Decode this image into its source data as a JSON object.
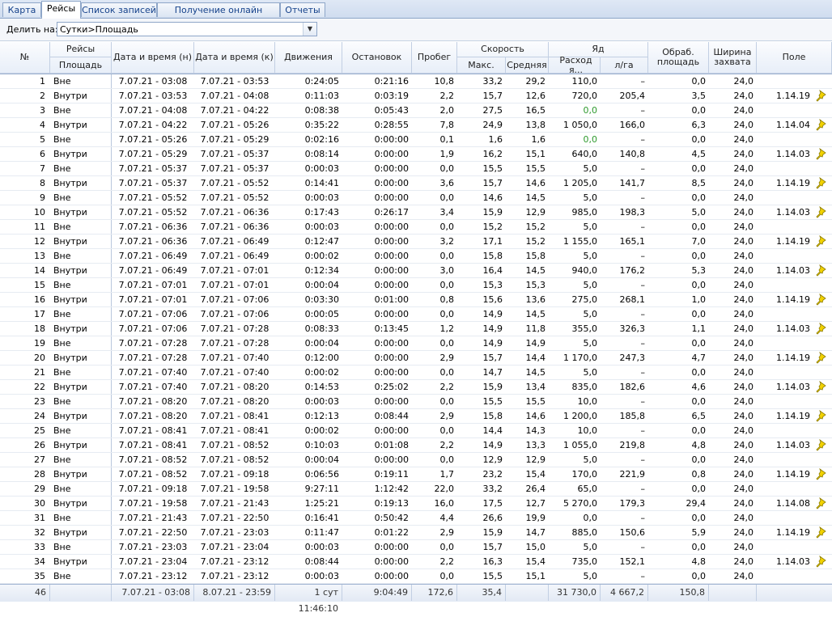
{
  "tabs": [
    {
      "label": "Карта",
      "active": false
    },
    {
      "label": "Рейсы",
      "active": true
    },
    {
      "label": "Список записей",
      "active": false
    },
    {
      "label": "Получение онлайн данных",
      "active": false
    },
    {
      "label": "Отчеты",
      "active": false
    }
  ],
  "toolbar": {
    "split_label": "Делить на:",
    "split_value": "Сутки>Площадь"
  },
  "columns": {
    "num": "№",
    "trips": "Рейсы",
    "area": "Площадь",
    "dt_start": "Дата и время (н)",
    "dt_end": "Дата и время (к)",
    "moving": "Движения",
    "stops": "Остановок",
    "mileage": "Пробег",
    "speed": "Скорость",
    "speed_max": "Макс.",
    "speed_avg": "Средняя",
    "poison": "Яд",
    "poison_use": "Расход я...",
    "poison_per_ha": "л/га",
    "processed": "Обраб. площадь",
    "width": "Ширина захвата",
    "field": "Поле"
  },
  "rows": [
    [
      "1",
      "Вне",
      "7.07.21 - 03:08",
      "7.07.21 - 03:53",
      "0:24:05",
      "0:21:16",
      "10,8",
      "33,2",
      "29,2",
      "110,0",
      "–",
      "0,0",
      "24,0",
      ""
    ],
    [
      "2",
      "Внутри",
      "7.07.21 - 03:53",
      "7.07.21 - 04:08",
      "0:11:03",
      "0:03:19",
      "2,2",
      "15,7",
      "12,6",
      "720,0",
      "205,4",
      "3,5",
      "24,0",
      "1.14.19"
    ],
    [
      "3",
      "Вне",
      "7.07.21 - 04:08",
      "7.07.21 - 04:22",
      "0:08:38",
      "0:05:43",
      "2,0",
      "27,5",
      "16,5",
      "0,0",
      "–",
      "0,0",
      "24,0",
      ""
    ],
    [
      "4",
      "Внутри",
      "7.07.21 - 04:22",
      "7.07.21 - 05:26",
      "0:35:22",
      "0:28:55",
      "7,8",
      "24,9",
      "13,8",
      "1 050,0",
      "166,0",
      "6,3",
      "24,0",
      "1.14.04"
    ],
    [
      "5",
      "Вне",
      "7.07.21 - 05:26",
      "7.07.21 - 05:29",
      "0:02:16",
      "0:00:00",
      "0,1",
      "1,6",
      "1,6",
      "0,0",
      "–",
      "0,0",
      "24,0",
      ""
    ],
    [
      "6",
      "Внутри",
      "7.07.21 - 05:29",
      "7.07.21 - 05:37",
      "0:08:14",
      "0:00:00",
      "1,9",
      "16,2",
      "15,1",
      "640,0",
      "140,8",
      "4,5",
      "24,0",
      "1.14.03"
    ],
    [
      "7",
      "Вне",
      "7.07.21 - 05:37",
      "7.07.21 - 05:37",
      "0:00:03",
      "0:00:00",
      "0,0",
      "15,5",
      "15,5",
      "5,0",
      "–",
      "0,0",
      "24,0",
      ""
    ],
    [
      "8",
      "Внутри",
      "7.07.21 - 05:37",
      "7.07.21 - 05:52",
      "0:14:41",
      "0:00:00",
      "3,6",
      "15,7",
      "14,6",
      "1 205,0",
      "141,7",
      "8,5",
      "24,0",
      "1.14.19"
    ],
    [
      "9",
      "Вне",
      "7.07.21 - 05:52",
      "7.07.21 - 05:52",
      "0:00:03",
      "0:00:00",
      "0,0",
      "14,6",
      "14,5",
      "5,0",
      "–",
      "0,0",
      "24,0",
      ""
    ],
    [
      "10",
      "Внутри",
      "7.07.21 - 05:52",
      "7.07.21 - 06:36",
      "0:17:43",
      "0:26:17",
      "3,4",
      "15,9",
      "12,9",
      "985,0",
      "198,3",
      "5,0",
      "24,0",
      "1.14.03"
    ],
    [
      "11",
      "Вне",
      "7.07.21 - 06:36",
      "7.07.21 - 06:36",
      "0:00:03",
      "0:00:00",
      "0,0",
      "15,2",
      "15,2",
      "5,0",
      "–",
      "0,0",
      "24,0",
      ""
    ],
    [
      "12",
      "Внутри",
      "7.07.21 - 06:36",
      "7.07.21 - 06:49",
      "0:12:47",
      "0:00:00",
      "3,2",
      "17,1",
      "15,2",
      "1 155,0",
      "165,1",
      "7,0",
      "24,0",
      "1.14.19"
    ],
    [
      "13",
      "Вне",
      "7.07.21 - 06:49",
      "7.07.21 - 06:49",
      "0:00:02",
      "0:00:00",
      "0,0",
      "15,8",
      "15,8",
      "5,0",
      "–",
      "0,0",
      "24,0",
      ""
    ],
    [
      "14",
      "Внутри",
      "7.07.21 - 06:49",
      "7.07.21 - 07:01",
      "0:12:34",
      "0:00:00",
      "3,0",
      "16,4",
      "14,5",
      "940,0",
      "176,2",
      "5,3",
      "24,0",
      "1.14.03"
    ],
    [
      "15",
      "Вне",
      "7.07.21 - 07:01",
      "7.07.21 - 07:01",
      "0:00:04",
      "0:00:00",
      "0,0",
      "15,3",
      "15,3",
      "5,0",
      "–",
      "0,0",
      "24,0",
      ""
    ],
    [
      "16",
      "Внутри",
      "7.07.21 - 07:01",
      "7.07.21 - 07:06",
      "0:03:30",
      "0:01:00",
      "0,8",
      "15,6",
      "13,6",
      "275,0",
      "268,1",
      "1,0",
      "24,0",
      "1.14.19"
    ],
    [
      "17",
      "Вне",
      "7.07.21 - 07:06",
      "7.07.21 - 07:06",
      "0:00:05",
      "0:00:00",
      "0,0",
      "14,9",
      "14,5",
      "5,0",
      "–",
      "0,0",
      "24,0",
      ""
    ],
    [
      "18",
      "Внутри",
      "7.07.21 - 07:06",
      "7.07.21 - 07:28",
      "0:08:33",
      "0:13:45",
      "1,2",
      "14,9",
      "11,8",
      "355,0",
      "326,3",
      "1,1",
      "24,0",
      "1.14.03"
    ],
    [
      "19",
      "Вне",
      "7.07.21 - 07:28",
      "7.07.21 - 07:28",
      "0:00:04",
      "0:00:00",
      "0,0",
      "14,9",
      "14,9",
      "5,0",
      "–",
      "0,0",
      "24,0",
      ""
    ],
    [
      "20",
      "Внутри",
      "7.07.21 - 07:28",
      "7.07.21 - 07:40",
      "0:12:00",
      "0:00:00",
      "2,9",
      "15,7",
      "14,4",
      "1 170,0",
      "247,3",
      "4,7",
      "24,0",
      "1.14.19"
    ],
    [
      "21",
      "Вне",
      "7.07.21 - 07:40",
      "7.07.21 - 07:40",
      "0:00:02",
      "0:00:00",
      "0,0",
      "14,7",
      "14,5",
      "5,0",
      "–",
      "0,0",
      "24,0",
      ""
    ],
    [
      "22",
      "Внутри",
      "7.07.21 - 07:40",
      "7.07.21 - 08:20",
      "0:14:53",
      "0:25:02",
      "2,2",
      "15,9",
      "13,4",
      "835,0",
      "182,6",
      "4,6",
      "24,0",
      "1.14.03"
    ],
    [
      "23",
      "Вне",
      "7.07.21 - 08:20",
      "7.07.21 - 08:20",
      "0:00:03",
      "0:00:00",
      "0,0",
      "15,5",
      "15,5",
      "10,0",
      "–",
      "0,0",
      "24,0",
      ""
    ],
    [
      "24",
      "Внутри",
      "7.07.21 - 08:20",
      "7.07.21 - 08:41",
      "0:12:13",
      "0:08:44",
      "2,9",
      "15,8",
      "14,6",
      "1 200,0",
      "185,8",
      "6,5",
      "24,0",
      "1.14.19"
    ],
    [
      "25",
      "Вне",
      "7.07.21 - 08:41",
      "7.07.21 - 08:41",
      "0:00:02",
      "0:00:00",
      "0,0",
      "14,4",
      "14,3",
      "10,0",
      "–",
      "0,0",
      "24,0",
      ""
    ],
    [
      "26",
      "Внутри",
      "7.07.21 - 08:41",
      "7.07.21 - 08:52",
      "0:10:03",
      "0:01:08",
      "2,2",
      "14,9",
      "13,3",
      "1 055,0",
      "219,8",
      "4,8",
      "24,0",
      "1.14.03"
    ],
    [
      "27",
      "Вне",
      "7.07.21 - 08:52",
      "7.07.21 - 08:52",
      "0:00:04",
      "0:00:00",
      "0,0",
      "12,9",
      "12,9",
      "5,0",
      "–",
      "0,0",
      "24,0",
      ""
    ],
    [
      "28",
      "Внутри",
      "7.07.21 - 08:52",
      "7.07.21 - 09:18",
      "0:06:56",
      "0:19:11",
      "1,7",
      "23,2",
      "15,4",
      "170,0",
      "221,9",
      "0,8",
      "24,0",
      "1.14.19"
    ],
    [
      "29",
      "Вне",
      "7.07.21 - 09:18",
      "7.07.21 - 19:58",
      "9:27:11",
      "1:12:42",
      "22,0",
      "33,2",
      "26,4",
      "65,0",
      "–",
      "0,0",
      "24,0",
      ""
    ],
    [
      "30",
      "Внутри",
      "7.07.21 - 19:58",
      "7.07.21 - 21:43",
      "1:25:21",
      "0:19:13",
      "16,0",
      "17,5",
      "12,7",
      "5 270,0",
      "179,3",
      "29,4",
      "24,0",
      "1.14.08"
    ],
    [
      "31",
      "Вне",
      "7.07.21 - 21:43",
      "7.07.21 - 22:50",
      "0:16:41",
      "0:50:42",
      "4,4",
      "26,6",
      "19,9",
      "0,0",
      "–",
      "0,0",
      "24,0",
      ""
    ],
    [
      "32",
      "Внутри",
      "7.07.21 - 22:50",
      "7.07.21 - 23:03",
      "0:11:47",
      "0:01:22",
      "2,9",
      "15,9",
      "14,7",
      "885,0",
      "150,6",
      "5,9",
      "24,0",
      "1.14.19"
    ],
    [
      "33",
      "Вне",
      "7.07.21 - 23:03",
      "7.07.21 - 23:04",
      "0:00:03",
      "0:00:00",
      "0,0",
      "15,7",
      "15,0",
      "5,0",
      "–",
      "0,0",
      "24,0",
      ""
    ],
    [
      "34",
      "Внутри",
      "7.07.21 - 23:04",
      "7.07.21 - 23:12",
      "0:08:44",
      "0:00:00",
      "2,2",
      "16,3",
      "15,4",
      "735,0",
      "152,1",
      "4,8",
      "24,0",
      "1.14.03"
    ],
    [
      "35",
      "Вне",
      "7.07.21 - 23:12",
      "7.07.21 - 23:12",
      "0:00:03",
      "0:00:00",
      "0,0",
      "15,5",
      "15,1",
      "5,0",
      "–",
      "0,0",
      "24,0",
      ""
    ]
  ],
  "green_poison_rows": [
    3,
    5
  ],
  "footer": {
    "count": "46",
    "dt_start": "7.07.21 - 03:08",
    "dt_end": "8.07.21 - 23:59",
    "moving": "1 сут 11:46:10",
    "stops": "9:04:49",
    "mileage": "172,6",
    "speed_max": "35,4",
    "poison_use": "31 730,0",
    "poison_per_ha": "4 667,2",
    "processed": "150,8"
  },
  "colors": {
    "accent": "#15428b",
    "green_value": "#2e9a2e",
    "pin": "#f2d200"
  }
}
